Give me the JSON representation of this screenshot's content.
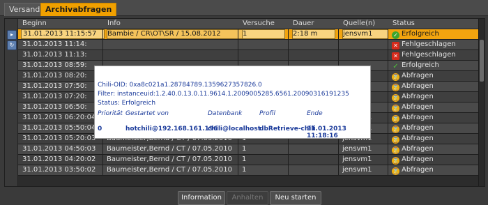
{
  "tabs": [
    {
      "label": "Versand"
    },
    {
      "label": "Archivabfragen"
    }
  ],
  "columns": {
    "begin": "Beginn",
    "info": "Info",
    "versuche": "Versuche",
    "dauer": "Dauer",
    "quelle": "Quelle(n)",
    "status": "Status"
  },
  "rows": [
    {
      "begin": "31.01.2013 11:15:57",
      "info": "Bambie / CR\\OT\\SR / 15.08.2012",
      "versuche": "1",
      "dauer": "2:18 m",
      "quelle": "jensvm1",
      "status": "Erfolgreich",
      "icon": "check-circle-icon"
    },
    {
      "begin": "31.01.2013 11:14:",
      "info": "",
      "versuche": "",
      "dauer": "",
      "quelle": "",
      "status": "Fehlgeschlagen",
      "icon": "x-icon"
    },
    {
      "begin": "31.01.2013 11:13:",
      "info": "",
      "versuche": "",
      "dauer": "",
      "quelle": "",
      "status": "Fehlgeschlagen",
      "icon": "x-icon"
    },
    {
      "begin": "31.01.2013 08:59:",
      "info": "",
      "versuche": "",
      "dauer": "",
      "quelle": "",
      "status": "Erfolgreich",
      "icon": "checkmark-icon"
    },
    {
      "begin": "31.01.2013 08:20:",
      "info": "",
      "versuche": "",
      "dauer": "",
      "quelle": "",
      "status": "Abfragen",
      "icon": "hourglass-icon"
    },
    {
      "begin": "31.01.2013 07:50:",
      "info": "",
      "versuche": "",
      "dauer": "",
      "quelle": "",
      "status": "Abfragen",
      "icon": "hourglass-icon"
    },
    {
      "begin": "31.01.2013 07:20:",
      "info": "",
      "versuche": "",
      "dauer": "",
      "quelle": "",
      "status": "Abfragen",
      "icon": "hourglass-icon"
    },
    {
      "begin": "31.01.2013 06:50:",
      "info": "",
      "versuche": "",
      "dauer": "",
      "quelle": "",
      "status": "Abfragen",
      "icon": "hourglass-icon"
    },
    {
      "begin": "31.01.2013 06:20:04",
      "info": "Baumeister,Bernd / CT / 07.05.2010",
      "versuche": "1",
      "dauer": "",
      "quelle": "jensvm1",
      "status": "Abfragen",
      "icon": "hourglass-icon"
    },
    {
      "begin": "31.01.2013 05:50:04",
      "info": "Baumeister,Bernd / CT / 07.05.2010",
      "versuche": "1",
      "dauer": "",
      "quelle": "jensvm1",
      "status": "Abfragen",
      "icon": "hourglass-icon"
    },
    {
      "begin": "31.01.2013 05:20:03",
      "info": "Baumeister,Bernd / CT / 07.05.2010",
      "versuche": "1",
      "dauer": "",
      "quelle": "jensvm1",
      "status": "Abfragen",
      "icon": "hourglass-icon"
    },
    {
      "begin": "31.01.2013 04:50:03",
      "info": "Baumeister,Bernd / CT / 07.05.2010",
      "versuche": "1",
      "dauer": "",
      "quelle": "jensvm1",
      "status": "Abfragen",
      "icon": "hourglass-icon"
    },
    {
      "begin": "31.01.2013 04:20:02",
      "info": "Baumeister,Bernd / CT / 07.05.2010",
      "versuche": "1",
      "dauer": "",
      "quelle": "jensvm1",
      "status": "Abfragen",
      "icon": "hourglass-icon"
    },
    {
      "begin": "31.01.2013 03:50:02",
      "info": "Baumeister,Bernd / CT / 07.05.2010",
      "versuche": "1",
      "dauer": "",
      "quelle": "jensvm1",
      "status": "Abfragen",
      "icon": "hourglass-icon"
    }
  ],
  "tooltip": {
    "oid": "Chili-OID: 0xa8c021a1.28784789.1359627357826.0",
    "filter": "Filter: instanceuid:1.2.40.0.13.0.11.9614.1.2009005285.6561.20090316191235",
    "status": "Status: Erfolgreich",
    "headers": {
      "prioritaet": "Priorität",
      "gestartet": "Gestartet von",
      "datenbank": "Datenbank",
      "profil": "Profil",
      "ende": "Ende"
    },
    "values": {
      "prioritaet": "0",
      "gestartet": "hotchili@192.168.161.196",
      "datenbank": "chili@localhost",
      "profil": "dbRetrieve-chili",
      "ende": "31.01.2013 11:18:16"
    }
  },
  "buttons": {
    "information": "Information",
    "anhalten": "Anhalten",
    "neu_starten": "Neu starten"
  }
}
